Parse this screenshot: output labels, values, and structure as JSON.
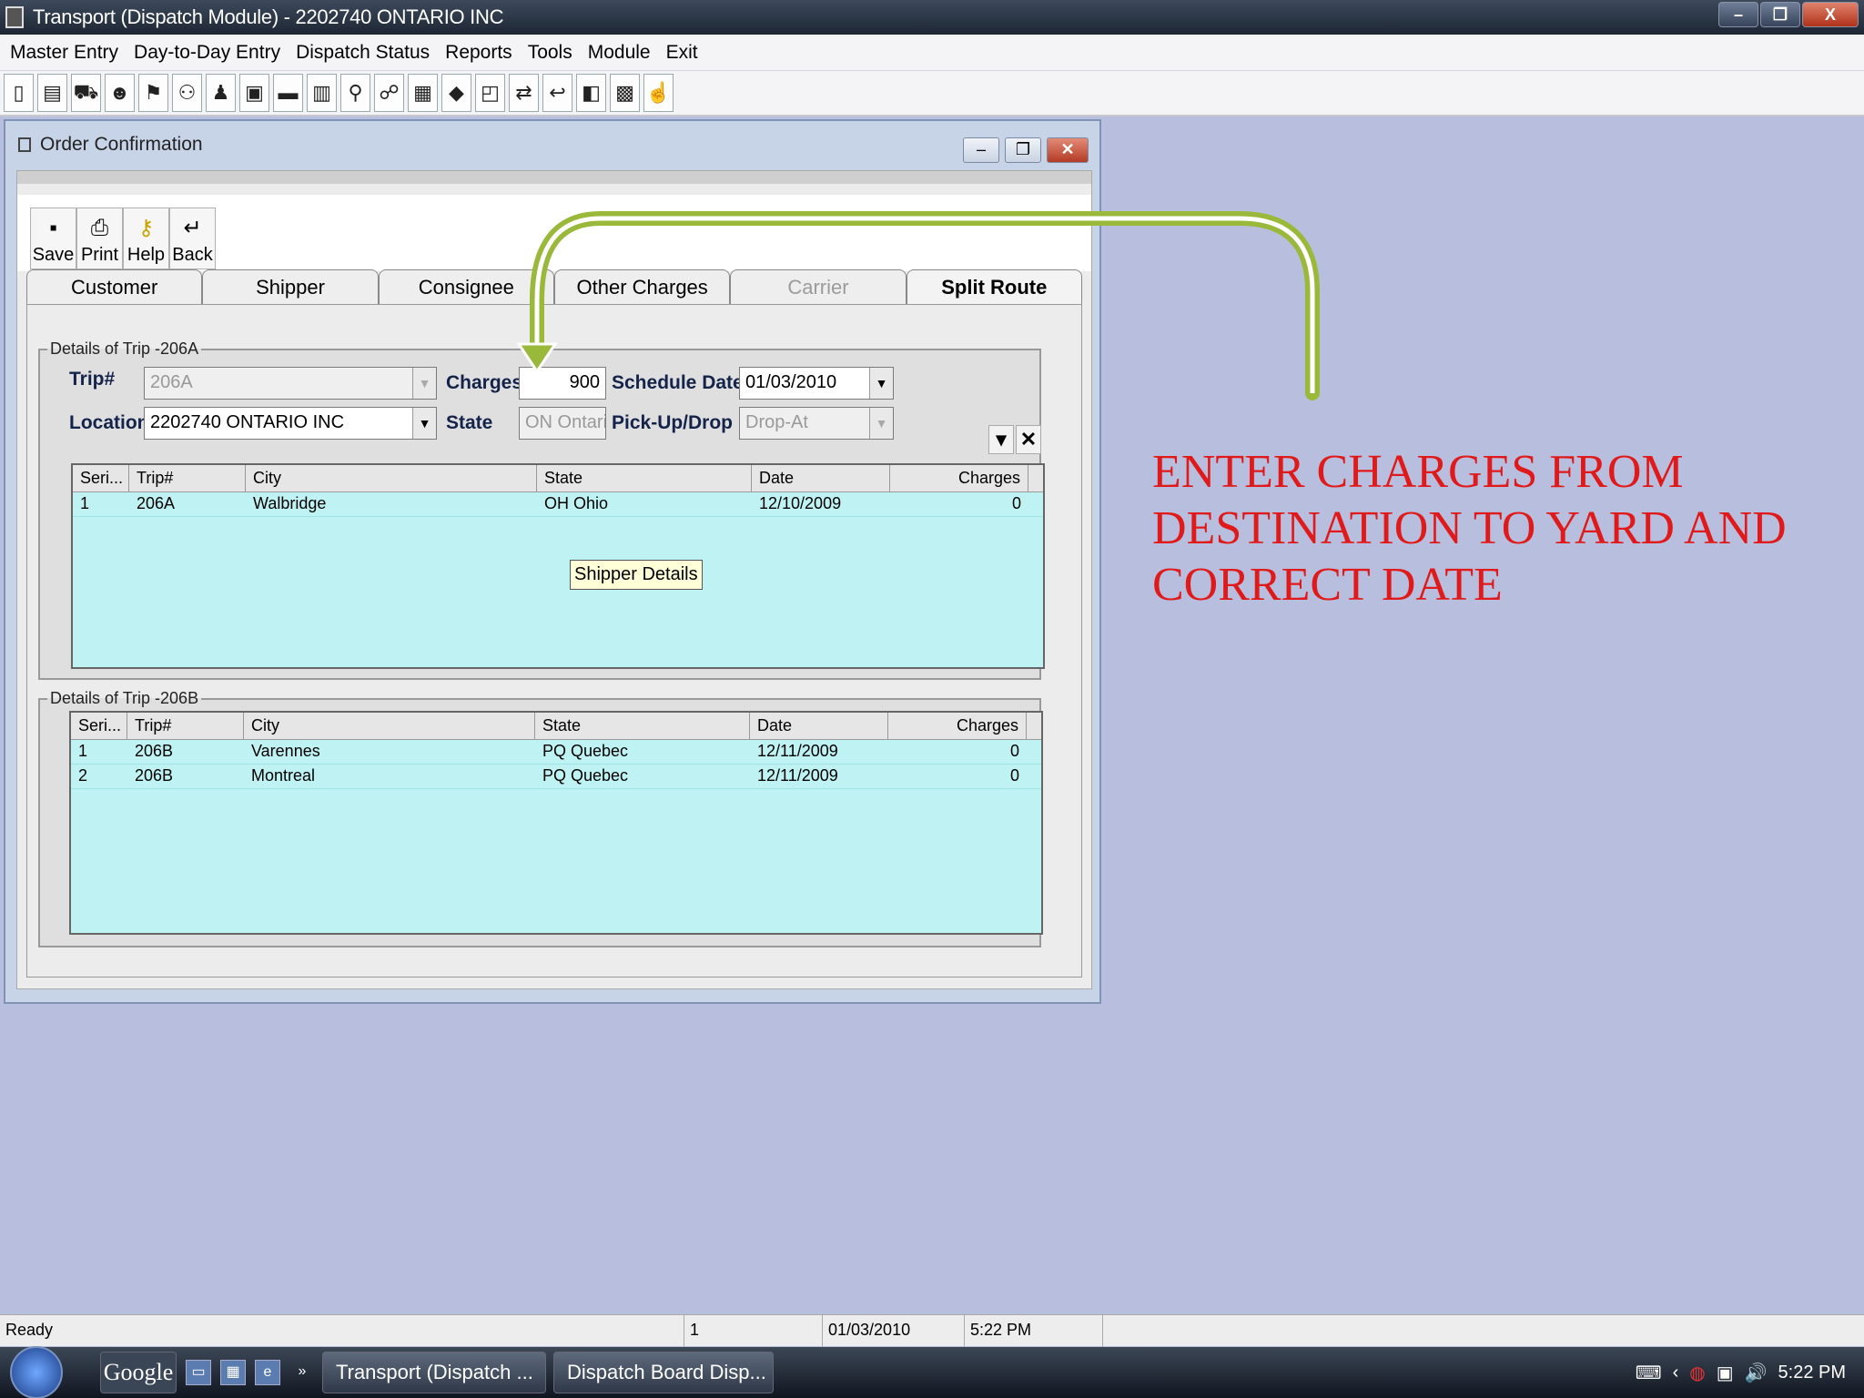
{
  "window": {
    "title": "Transport (Dispatch Module) - 2202740 ONTARIO INC"
  },
  "menu": [
    "Master Entry",
    "Day-to-Day Entry",
    "Dispatch Status",
    "Reports",
    "Tools",
    "Module",
    "Exit"
  ],
  "child": {
    "title": "Order Confirmation",
    "buttons": {
      "save": "Save",
      "print": "Print",
      "help": "Help",
      "back": "Back"
    },
    "tabs": {
      "customer": "Customer",
      "shipper": "Shipper",
      "consignee": "Consignee",
      "other": "Other Charges",
      "carrier": "Carrier",
      "split": "Split Route"
    }
  },
  "trip_a": {
    "legend": "Details of Trip -206A",
    "labels": {
      "trip": "Trip#",
      "charges": "Charges",
      "schedule": "Schedule Date",
      "location": "Location",
      "state": "State",
      "pickup": "Pick-Up/Drop"
    },
    "trip": "206A",
    "charges": "900",
    "schedule_date": "01/03/2010",
    "location": "2202740 ONTARIO INC",
    "state": "ON  Ontario",
    "pickup_drop": "Drop-At",
    "columns": [
      "Seri...",
      "Trip#",
      "City",
      "State",
      "Date",
      "Charges"
    ],
    "rows": [
      {
        "seri": "1",
        "trip": "206A",
        "city": "Walbridge",
        "state": "OH  Ohio",
        "date": "12/10/2009",
        "charges": "0"
      }
    ],
    "tooltip": "Shipper Details"
  },
  "trip_b": {
    "legend": "Details of Trip -206B",
    "columns": [
      "Seri...",
      "Trip#",
      "City",
      "State",
      "Date",
      "Charges"
    ],
    "rows": [
      {
        "seri": "1",
        "trip": "206B",
        "city": "Varennes",
        "state": "PQ  Quebec",
        "date": "12/11/2009",
        "charges": "0"
      },
      {
        "seri": "2",
        "trip": "206B",
        "city": "Montreal",
        "state": "PQ  Quebec",
        "date": "12/11/2009",
        "charges": "0"
      }
    ]
  },
  "annotation": {
    "text": "ENTER CHARGES FROM DESTINATION TO YARD AND CORRECT DATE",
    "color": "#e01a1a",
    "arrow_color": "#9ab83a"
  },
  "status": {
    "ready": "Ready",
    "page": "1",
    "date": "01/03/2010",
    "time": "5:22 PM"
  },
  "taskbar": {
    "google": "Google",
    "tasks": [
      "Transport (Dispatch ...",
      "Dispatch Board Disp..."
    ],
    "clock": "5:22 PM"
  }
}
